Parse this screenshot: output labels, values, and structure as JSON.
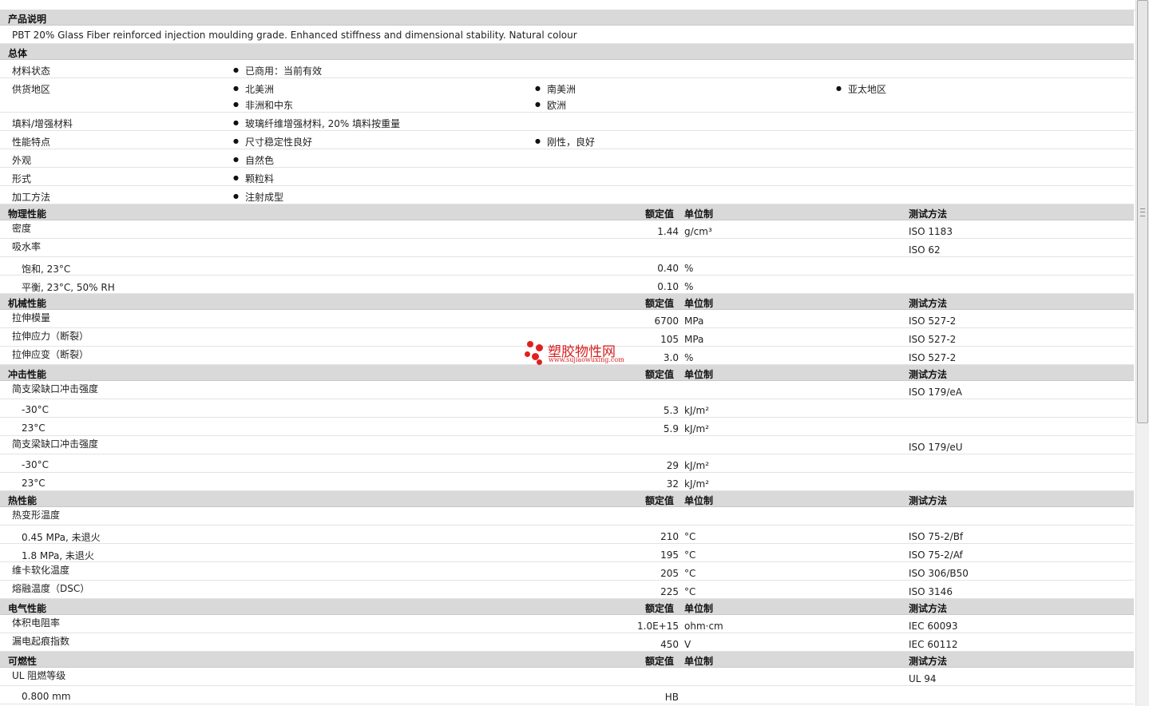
{
  "description": {
    "header": "产品说明",
    "text": "PBT 20% Glass Fiber reinforced injection moulding grade. Enhanced stiffness and dimensional stability. Natural colour"
  },
  "general": {
    "header": "总体",
    "rows": [
      {
        "label": "材料状态",
        "values": [
          "已商用：当前有效"
        ]
      },
      {
        "label": "供货地区",
        "values": [
          "北美洲",
          "南美洲",
          "亚太地区",
          "非洲和中东",
          "欧洲"
        ]
      },
      {
        "label": "填料/增强材料",
        "values": [
          "玻璃纤维增强材料, 20% 填料按重量"
        ]
      },
      {
        "label": "性能特点",
        "values": [
          "尺寸稳定性良好",
          "刚性，良好"
        ]
      },
      {
        "label": "外观",
        "values": [
          "自然色"
        ]
      },
      {
        "label": "形式",
        "values": [
          "颗粒料"
        ]
      },
      {
        "label": "加工方法",
        "values": [
          "注射成型"
        ]
      }
    ]
  },
  "columns": {
    "nominal": "额定值",
    "unit": "单位制",
    "method": "测试方法"
  },
  "sections": [
    {
      "title": "物理性能",
      "rows": [
        {
          "label": "密度",
          "value": "1.44",
          "unit": "g/cm³",
          "method": "ISO 1183"
        },
        {
          "label": "吸水率",
          "value": "",
          "unit": "",
          "method": "ISO 62"
        },
        {
          "label": "饱和, 23°C",
          "value": "0.40",
          "unit": "%",
          "method": "",
          "sub": true
        },
        {
          "label": "平衡, 23°C, 50% RH",
          "value": "0.10",
          "unit": "%",
          "method": "",
          "sub": true
        }
      ]
    },
    {
      "title": "机械性能",
      "rows": [
        {
          "label": "拉伸模量",
          "value": "6700",
          "unit": "MPa",
          "method": "ISO 527-2"
        },
        {
          "label": "拉伸应力（断裂）",
          "value": "105",
          "unit": "MPa",
          "method": "ISO 527-2"
        },
        {
          "label": "拉伸应变（断裂）",
          "value": "3.0",
          "unit": "%",
          "method": "ISO 527-2"
        }
      ]
    },
    {
      "title": "冲击性能",
      "rows": [
        {
          "label": "简支梁缺口冲击强度",
          "value": "",
          "unit": "",
          "method": "ISO 179/eA"
        },
        {
          "label": "-30°C",
          "value": "5.3",
          "unit": "kJ/m²",
          "method": "",
          "sub": true
        },
        {
          "label": "23°C",
          "value": "5.9",
          "unit": "kJ/m²",
          "method": "",
          "sub": true
        },
        {
          "label": "简支梁缺口冲击强度",
          "value": "",
          "unit": "",
          "method": "ISO 179/eU"
        },
        {
          "label": "-30°C",
          "value": "29",
          "unit": "kJ/m²",
          "method": "",
          "sub": true
        },
        {
          "label": "23°C",
          "value": "32",
          "unit": "kJ/m²",
          "method": "",
          "sub": true
        }
      ]
    },
    {
      "title": "热性能",
      "rows": [
        {
          "label": "热变形温度",
          "value": "",
          "unit": "",
          "method": ""
        },
        {
          "label": "0.45 MPa, 未退火",
          "value": "210",
          "unit": "°C",
          "method": "ISO 75-2/Bf",
          "sub": true
        },
        {
          "label": "1.8 MPa, 未退火",
          "value": "195",
          "unit": "°C",
          "method": "ISO 75-2/Af",
          "sub": true
        },
        {
          "label": "维卡软化温度",
          "value": "205",
          "unit": "°C",
          "method": "ISO 306/B50"
        },
        {
          "label": "熔融温度（DSC）",
          "value": "225",
          "unit": "°C",
          "method": "ISO 3146"
        }
      ]
    },
    {
      "title": "电气性能",
      "rows": [
        {
          "label": "体积电阻率",
          "value": "1.0E+15",
          "unit": "ohm·cm",
          "method": "IEC 60093"
        },
        {
          "label": "漏电起痕指数",
          "value": "450",
          "unit": "V",
          "method": "IEC 60112"
        }
      ]
    },
    {
      "title": "可燃性",
      "rows": [
        {
          "label": "UL 阻燃等级",
          "value": "",
          "unit": "",
          "method": "UL 94"
        },
        {
          "label": "0.800 mm",
          "value": "HB",
          "unit": "",
          "method": "",
          "sub": true
        }
      ]
    }
  ],
  "watermark": {
    "title": "塑胶物性网",
    "url": "www.sujiaowuxing.com",
    "color": "#e02020"
  }
}
